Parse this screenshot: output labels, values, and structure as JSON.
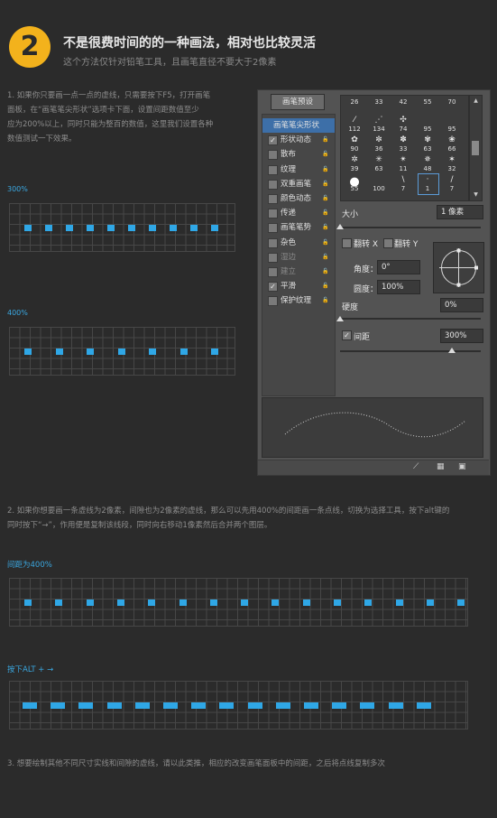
{
  "header": {
    "step_number": "2",
    "title": "不是很费时间的的一种画法，相对也比较灵活",
    "subtitle": "这个方法仅针对铅笔工具，且画笔直径不要大于2像素"
  },
  "paragraph1": {
    "line1": "1. 如果你只要画一点一点的虚线，只需要按下F5，打开画笔",
    "line2": "面板，在“画笔笔尖形状”选项卡下面，设置间距数值至少",
    "line3": "应为200%以上，同时只能为整百的数值，这里我们设置各种",
    "line4": "数值测试一下效果。"
  },
  "labels": {
    "spacing300": "300%",
    "spacing400": "400%",
    "spacing_is_400": "间距为400%",
    "press_alt": "按下ALT + →"
  },
  "paragraph2": {
    "line1": "2. 如果你想要画一条虚线为2像素，间隙也为2像素的虚线，那么可以先用400%的间距画一条点线，切换为选择工具，按下alt键的",
    "line2": "同时按下“→”，作用便是复制该线段，同时向右移动1像素然后合并两个图层。"
  },
  "paragraph3": {
    "line1": "3. 想要绘制其他不同尺寸实线和间隙的虚线，请以此类推，相应的改变画笔面板中的间距，之后将点线复制多次"
  },
  "panel": {
    "preset_button": "画笔预设",
    "options": [
      {
        "label": "画笔笔尖形状",
        "checked": false,
        "state": "selected"
      },
      {
        "label": "形状动态",
        "checked": true,
        "state": "normal"
      },
      {
        "label": "散布",
        "checked": false,
        "state": "normal"
      },
      {
        "label": "纹理",
        "checked": false,
        "state": "normal"
      },
      {
        "label": "双重画笔",
        "checked": false,
        "state": "normal"
      },
      {
        "label": "颜色动态",
        "checked": false,
        "state": "normal"
      },
      {
        "label": "传递",
        "checked": false,
        "state": "normal"
      },
      {
        "label": "画笔笔势",
        "checked": false,
        "state": "normal"
      },
      {
        "label": "杂色",
        "checked": false,
        "state": "normal"
      },
      {
        "label": "湿边",
        "checked": false,
        "state": "disabled"
      },
      {
        "label": "建立",
        "checked": false,
        "state": "disabled"
      },
      {
        "label": "平滑",
        "checked": true,
        "state": "normal"
      },
      {
        "label": "保护纹理",
        "checked": false,
        "state": "normal"
      }
    ],
    "tips_row1": [
      "26",
      "33",
      "42",
      "55",
      "70"
    ],
    "tips_row2": [
      "112",
      "134",
      "74",
      "95",
      "95"
    ],
    "tips_row3": [
      "90",
      "36",
      "33",
      "63",
      "66"
    ],
    "tips_row4": [
      "39",
      "63",
      "11",
      "48",
      "32"
    ],
    "tips_row5": [
      "55",
      "100",
      "7",
      "1",
      "7"
    ],
    "size_label": "大小",
    "size_value": "1 像素",
    "flip_x": "翻转 X",
    "flip_y": "翻转 Y",
    "angle_label": "角度：",
    "angle_value": "0°",
    "roundness_label": "圆度：",
    "roundness_value": "100%",
    "hardness_label": "硬度",
    "hardness_value": "0%",
    "spacing_label": "间距",
    "spacing_value": "300%",
    "spacing_checked": true
  }
}
